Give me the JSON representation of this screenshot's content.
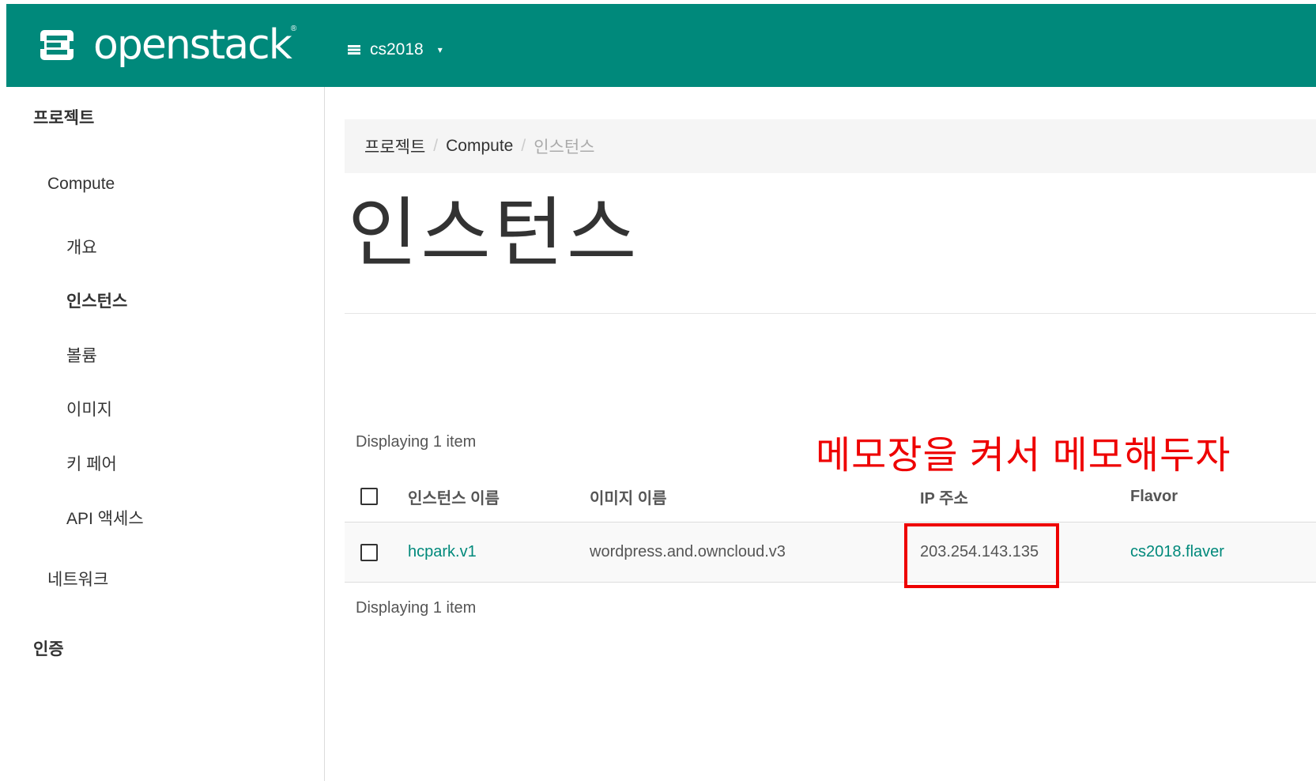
{
  "header": {
    "brand_name": "openstack",
    "brand_reg": "®",
    "project": "cs2018",
    "colors": {
      "topbar": "#00897b",
      "link": "#00897b",
      "annotation": "#ee0000"
    }
  },
  "sidebar": {
    "project": "프로젝트",
    "compute": "Compute",
    "overview": "개요",
    "instances": "인스턴스",
    "volumes": "볼륨",
    "images": "이미지",
    "keypairs": "키 페어",
    "api_access": "API 액세스",
    "network": "네트워크",
    "identity": "인증"
  },
  "breadcrumb": {
    "project": "프로젝트",
    "compute": "Compute",
    "current": "인스턴스",
    "separator": "/"
  },
  "page": {
    "title": "인스턴스",
    "count_top": "Displaying 1 item",
    "count_bottom": "Displaying 1 item"
  },
  "annotation": {
    "text": "메모장을 켜서 메모해두자"
  },
  "table": {
    "columns": {
      "name": "인스턴스 이름",
      "image": "이미지 이름",
      "ip": "IP 주소",
      "flavor": "Flavor"
    },
    "rows": [
      {
        "name": "hcpark.v1",
        "image": "wordpress.and.owncloud.v3",
        "ip": "203.254.143.135",
        "flavor": "cs2018.flaver"
      }
    ]
  }
}
